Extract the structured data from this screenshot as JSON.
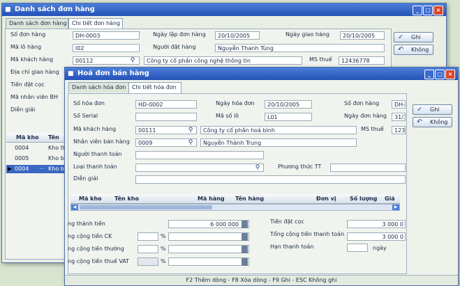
{
  "back_window": {
    "title": "Danh sách đơn hàng",
    "tabs": [
      "Danh sách đơn hàng",
      "Chi tiết đơn hàng"
    ],
    "labels": {
      "so_don_hang": "Số đơn hàng",
      "ma_lo_hang": "Mã lô hàng",
      "ma_khach_hang": "Mã khách hàng",
      "dia_chi": "Địa chỉ giao hàng",
      "tien_dat_coc": "Tiền đặt cọc",
      "ma_nhan_vien": "Mã nhân viên BH",
      "dien_giai": "Diễn giải",
      "ngay_lap": "Ngày lập đơn hàng",
      "ngay_giao": "Ngày giao hàng",
      "nguoi_dat": "Người đặt hàng",
      "ms_thue": "MS thuế"
    },
    "values": {
      "so_don_hang": "DH-0003",
      "ma_lo_hang": "l02",
      "ma_khach_hang": "00112",
      "ngay_lap": "20/10/2005",
      "ngay_giao": "20/10/2005",
      "nguoi_dat": "Nguyễn Thanh Tùng",
      "cong_ty": "Công ty cổ phần công nghệ thông tin",
      "ms_thue": "12436778"
    },
    "buttons": {
      "save": "Ghi",
      "cancel": "Không"
    },
    "grid": {
      "headers": [
        "Mã kho",
        "Tên"
      ],
      "rows": [
        {
          "ma": "0004",
          "ten": "Kho th"
        },
        {
          "ma": "0005",
          "ten": "Kho b"
        },
        {
          "ma": "0004",
          "ten": "Kho b"
        }
      ]
    }
  },
  "front_window": {
    "title": "Hoá đơn bán hàng",
    "tabs": [
      "Danh sách hóa đơn",
      "Chi tiết hóa đơn"
    ],
    "labels": {
      "so_hoa_don": "Số hóa đơn",
      "so_serial": "Số Serial",
      "ma_khach_hang": "Mã khách hàng",
      "nhan_vien": "Nhân viên bán hàng",
      "nguoi_thanh_toan": "Người thanh toán",
      "loai_thanh_toan": "Loại thanh toán",
      "dien_giai": "Diễn giải",
      "ngay_hoa_don": "Ngày hóa đơn",
      "ma_so_lo": "Mã số lô",
      "so_don_hang": "Số đơn hàng",
      "ngay_don_hang": "Ngày đơn hàng",
      "ms_thue": "MS thuế",
      "phuong_thuc": "Phương thức TT"
    },
    "values": {
      "so_hoa_don": "HD-0002",
      "ngay_hoa_don": "20/10/2005",
      "ma_so_lo": "L01",
      "so_don_hang": "DH-00",
      "ngay_don_hang": "31/10",
      "ma_khach_hang": "00111",
      "cong_ty": "Công ty cổ phần hoá bình",
      "ms_thue": "1234(",
      "nhan_vien": "0009",
      "ten_nhan_vien": "Nguyễn Thành Trung"
    },
    "buttons": {
      "save": "Ghi",
      "cancel": "Không"
    },
    "grid_headers": [
      "Mã kho",
      "Tên kho",
      "Mã hàng",
      "Tên hàng",
      "Đơn vị",
      "Số lượng",
      "Giá"
    ],
    "totals": {
      "thanh_tien_label": "ng thành tiền",
      "thanh_tien": "6 000 000",
      "ck_label": "ng cộng tiền CK",
      "thuong_label": "ng cộng tiền thưởng",
      "thue_label": "ng cộng tiền thuế VAT",
      "percent": "%",
      "dat_coc_label": "Tiền đặt cọc",
      "dat_coc": "3 000 0",
      "tong_label": "Tổng cộng tiền thanh toán",
      "tong": "3 000 0",
      "han_label": "Hạn thanh toán",
      "ngay": "ngày"
    },
    "status": "F2 Thêm dòng - F8 Xóa dòng - F9 Ghi - ESC Không ghi"
  },
  "colors": {
    "title": "#2f5fc8",
    "panel": "#f1f4ee",
    "background": "#d9e4cf"
  }
}
